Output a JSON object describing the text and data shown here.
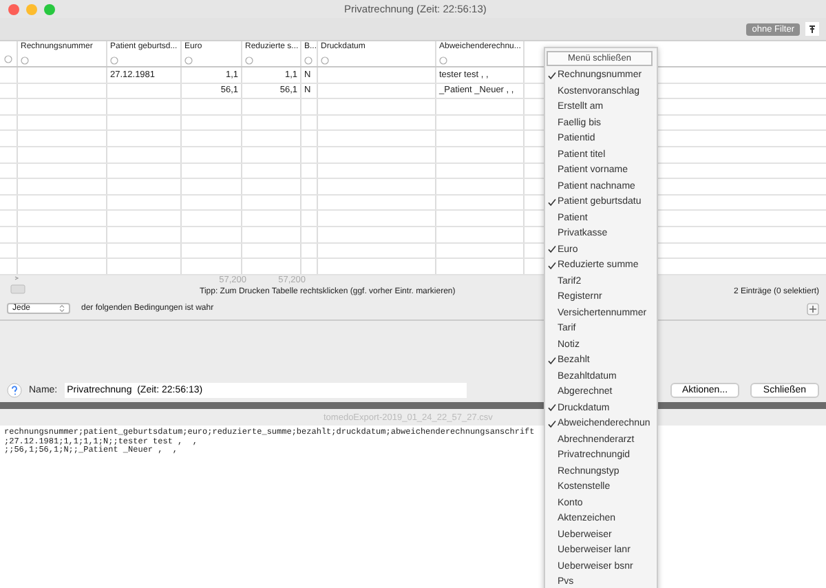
{
  "window": {
    "title": "Privatrechnung  (Zeit: 22:56:13)"
  },
  "toolbar": {
    "filter_button": "ohne Filter"
  },
  "table": {
    "columns": [
      {
        "label": "Rechnungsnummer"
      },
      {
        "label": "Patient geburtsd..."
      },
      {
        "label": "Euro",
        "total": "57,200"
      },
      {
        "label": "Reduzierte s...",
        "total": "57,200"
      },
      {
        "label": "B..."
      },
      {
        "label": "Druckdatum"
      },
      {
        "label": "Abweichenderechnu..."
      }
    ],
    "rows": [
      {
        "cells": [
          "",
          "27.12.1981",
          "1,1",
          "1,1",
          "N",
          "",
          "tester test ,  ,"
        ]
      },
      {
        "cells": [
          "",
          "",
          "56,1",
          "56,1",
          "N",
          "",
          "_Patient _Neuer ,  ,"
        ]
      }
    ]
  },
  "tip": "Tipp: Zum Drucken Tabelle rechtsklicken (ggf. vorher Eintr. markieren)",
  "count": "2 Einträge (0 selektiert)",
  "condition": {
    "select": "Jede",
    "text": "der folgenden Bedingungen ist wahr"
  },
  "name_label": "Name:",
  "name_value": "Privatrechnung  (Zeit: 22:56:13)",
  "buttons": [
    "Aktionen...",
    "Schließen"
  ],
  "csv_window": {
    "title": "tomedoExport-2019_01_24_22_57_27.csv",
    "lines": [
      "rechnungsnummer;patient_geburtsdatum;euro;reduzierte_summe;bezahlt;druckdatum;abweichenderechnungsanschrift",
      ";27.12.1981;1,1;1,1;N;;tester test ,  ,",
      ";;56,1;56,1;N;;_Patient _Neuer ,  ,"
    ]
  },
  "menu": {
    "close_label": "Menü schließen",
    "items": [
      {
        "label": "Rechnungsnummer",
        "checked": true
      },
      {
        "label": "Kostenvoranschlag",
        "checked": false
      },
      {
        "label": "Erstellt am",
        "checked": false
      },
      {
        "label": "Faellig bis",
        "checked": false
      },
      {
        "label": "Patientid",
        "checked": false
      },
      {
        "label": "Patient titel",
        "checked": false
      },
      {
        "label": "Patient vorname",
        "checked": false
      },
      {
        "label": "Patient nachname",
        "checked": false
      },
      {
        "label": "Patient geburtsdatu",
        "checked": true
      },
      {
        "label": "Patient",
        "checked": false
      },
      {
        "label": "Privatkasse",
        "checked": false
      },
      {
        "label": "Euro",
        "checked": true
      },
      {
        "label": "Reduzierte summe",
        "checked": true
      },
      {
        "label": "Tarif2",
        "checked": false
      },
      {
        "label": "Registernr",
        "checked": false
      },
      {
        "label": "Versichertennummer",
        "checked": false
      },
      {
        "label": "Tarif",
        "checked": false
      },
      {
        "label": "Notiz",
        "checked": false
      },
      {
        "label": "Bezahlt",
        "checked": true
      },
      {
        "label": "Bezahltdatum",
        "checked": false
      },
      {
        "label": "Abgerechnet",
        "checked": false
      },
      {
        "label": "Druckdatum",
        "checked": true
      },
      {
        "label": "Abweichenderechnun",
        "checked": true
      },
      {
        "label": "Abrechnenderarzt",
        "checked": false
      },
      {
        "label": "Privatrechnungid",
        "checked": false
      },
      {
        "label": "Rechnungstyp",
        "checked": false
      },
      {
        "label": "Kostenstelle",
        "checked": false
      },
      {
        "label": "Konto",
        "checked": false
      },
      {
        "label": "Aktenzeichen",
        "checked": false
      },
      {
        "label": "Ueberweiser",
        "checked": false
      },
      {
        "label": "Ueberweiser lanr",
        "checked": false
      },
      {
        "label": "Ueberweiser bsnr",
        "checked": false
      },
      {
        "label": "Pvs",
        "checked": false
      }
    ]
  }
}
